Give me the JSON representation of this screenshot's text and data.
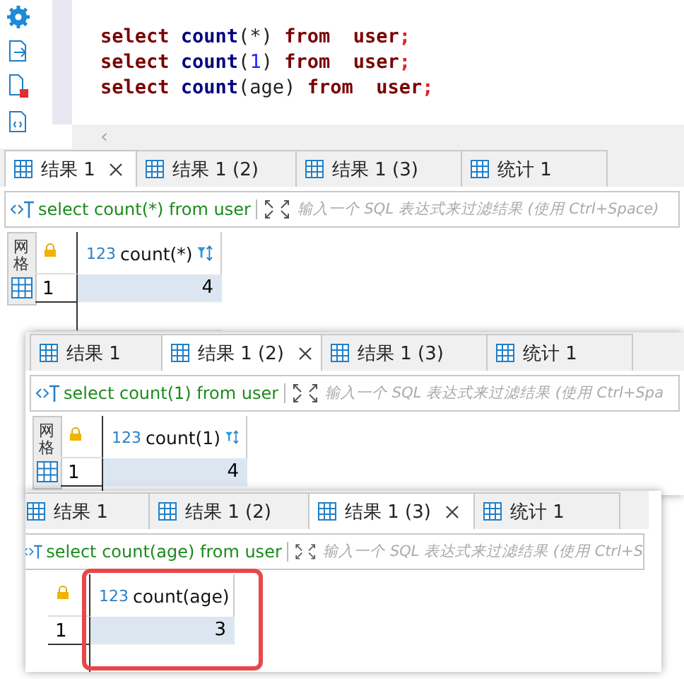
{
  "editor": {
    "lines": [
      [
        {
          "text": "select ",
          "kind": "keyword"
        },
        {
          "text": "count",
          "kind": "function"
        },
        {
          "text": "(*) ",
          "kind": "plain"
        },
        {
          "text": "from  ",
          "kind": "keyword"
        },
        {
          "text": "user",
          "kind": "keyword"
        },
        {
          "text": ";",
          "kind": "punct"
        }
      ],
      [
        {
          "text": "select ",
          "kind": "keyword"
        },
        {
          "text": "count",
          "kind": "function"
        },
        {
          "text": "(",
          "kind": "plain"
        },
        {
          "text": "1",
          "kind": "number"
        },
        {
          "text": ") ",
          "kind": "plain"
        },
        {
          "text": "from  ",
          "kind": "keyword"
        },
        {
          "text": "user",
          "kind": "keyword"
        },
        {
          "text": ";",
          "kind": "punct"
        }
      ],
      [
        {
          "text": "select ",
          "kind": "keyword"
        },
        {
          "text": "count",
          "kind": "function"
        },
        {
          "text": "(age) ",
          "kind": "plain"
        },
        {
          "text": "from  ",
          "kind": "keyword"
        },
        {
          "text": "user",
          "kind": "keyword"
        },
        {
          "text": ";",
          "kind": "punct"
        }
      ]
    ],
    "scroll_arrow": "‹"
  },
  "results": [
    {
      "tabs": [
        {
          "label": "结果 1",
          "selected": true
        },
        {
          "label": "结果 1 (2)",
          "selected": false
        },
        {
          "label": "结果 1 (3)",
          "selected": false
        },
        {
          "label": "统计 1",
          "selected": false
        }
      ],
      "query": "select count(*) from user",
      "placeholder": "输入一个 SQL 表达式来过滤结果 (使用 Ctrl+Space)",
      "side_tabs": [
        "网格"
      ],
      "column": {
        "type": "123",
        "name": "count(*)"
      },
      "rows": [
        {
          "number": "1",
          "value": "4"
        }
      ]
    },
    {
      "tabs": [
        {
          "label": "结果 1",
          "selected": false
        },
        {
          "label": "结果 1 (2)",
          "selected": true
        },
        {
          "label": "结果 1 (3)",
          "selected": false
        },
        {
          "label": "统计 1",
          "selected": false
        }
      ],
      "query": "select count(1) from user",
      "placeholder": "输入一个 SQL 表达式来过滤结果 (使用 Ctrl+Spa",
      "side_tabs": [
        "网格"
      ],
      "column": {
        "type": "123",
        "name": "count(1)"
      },
      "rows": [
        {
          "number": "1",
          "value": "4"
        }
      ]
    },
    {
      "tabs": [
        {
          "label": "结果 1",
          "selected": false
        },
        {
          "label": "结果 1 (2)",
          "selected": false
        },
        {
          "label": "结果 1 (3)",
          "selected": true
        },
        {
          "label": "统计 1",
          "selected": false
        }
      ],
      "query": "select count(age) from user",
      "placeholder": "输入一个 SQL 表达式来过滤结果 (使用 Ctrl+S",
      "column": {
        "type": "123",
        "name": "count(age)",
        "highlighted": true
      },
      "rows": [
        {
          "number": "1",
          "value": "3"
        }
      ]
    }
  ]
}
